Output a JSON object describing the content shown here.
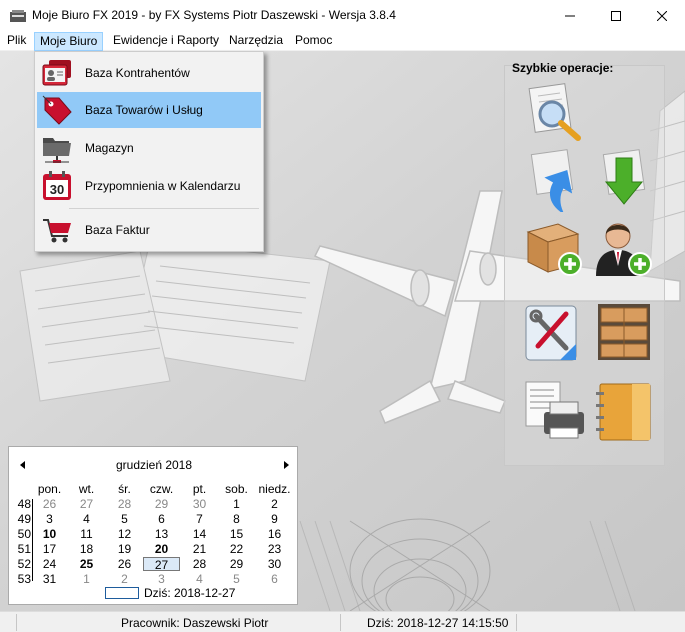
{
  "window": {
    "title": "Moje Biuro FX 2019 - by FX Systems Piotr Daszewski  - Wersja 3.8.4"
  },
  "menubar": {
    "items": [
      {
        "label": "Plik"
      },
      {
        "label": "Moje Biuro"
      },
      {
        "label": "Ewidencje i Raporty"
      },
      {
        "label": "Narzędzia"
      },
      {
        "label": "Pomoc"
      }
    ]
  },
  "dropdown": {
    "items": [
      {
        "label": "Baza Kontrahentów",
        "icon": "contacts-card-icon"
      },
      {
        "label": "Baza Towarów i Usług",
        "icon": "price-tag-icon"
      },
      {
        "label": "Magazyn",
        "icon": "network-folder-icon"
      },
      {
        "label": "Przypomnienia w Kalendarzu",
        "icon": "calendar-30-icon",
        "icon_text": "30"
      },
      {
        "label": "Baza Faktur",
        "icon": "shopping-cart-icon"
      }
    ],
    "highlighted_index": 1
  },
  "quick_ops": {
    "title": "Szybkie operacje:",
    "buttons": [
      {
        "icon": "invoice-search-icon"
      },
      {
        "icon": "invoice-export-icon"
      },
      {
        "icon": "invoice-import-icon"
      },
      {
        "icon": "add-goods-icon"
      },
      {
        "icon": "add-contractor-icon"
      },
      {
        "icon": "settings-tools-icon"
      },
      {
        "icon": "warehouse-shelves-icon"
      },
      {
        "icon": "print-document-icon"
      },
      {
        "icon": "address-book-icon"
      }
    ]
  },
  "calendar": {
    "month_label": "grudzień 2018",
    "day_headers": [
      "pon.",
      "wt.",
      "śr.",
      "czw.",
      "pt.",
      "sob.",
      "niedz."
    ],
    "weeks": [
      {
        "week": "48",
        "days": [
          {
            "d": "26",
            "other": true
          },
          {
            "d": "27",
            "other": true
          },
          {
            "d": "28",
            "other": true
          },
          {
            "d": "29",
            "other": true
          },
          {
            "d": "30",
            "other": true
          },
          {
            "d": "1"
          },
          {
            "d": "2"
          }
        ]
      },
      {
        "week": "49",
        "days": [
          {
            "d": "3"
          },
          {
            "d": "4"
          },
          {
            "d": "5"
          },
          {
            "d": "6"
          },
          {
            "d": "7"
          },
          {
            "d": "8"
          },
          {
            "d": "9"
          }
        ]
      },
      {
        "week": "50",
        "days": [
          {
            "d": "10",
            "bold": true
          },
          {
            "d": "11"
          },
          {
            "d": "12"
          },
          {
            "d": "13"
          },
          {
            "d": "14"
          },
          {
            "d": "15"
          },
          {
            "d": "16"
          }
        ]
      },
      {
        "week": "51",
        "days": [
          {
            "d": "17"
          },
          {
            "d": "18"
          },
          {
            "d": "19"
          },
          {
            "d": "20",
            "bold": true
          },
          {
            "d": "21"
          },
          {
            "d": "22"
          },
          {
            "d": "23"
          }
        ]
      },
      {
        "week": "52",
        "days": [
          {
            "d": "24"
          },
          {
            "d": "25",
            "bold": true
          },
          {
            "d": "26"
          },
          {
            "d": "27",
            "today": true
          },
          {
            "d": "28"
          },
          {
            "d": "29"
          },
          {
            "d": "30"
          }
        ]
      },
      {
        "week": "53",
        "days": [
          {
            "d": "31"
          },
          {
            "d": "1",
            "other": true
          },
          {
            "d": "2",
            "other": true
          },
          {
            "d": "3",
            "other": true
          },
          {
            "d": "4",
            "other": true
          },
          {
            "d": "5",
            "other": true
          },
          {
            "d": "6",
            "other": true
          }
        ]
      }
    ],
    "today_label": "Dziś: 2018-12-27"
  },
  "status": {
    "employee": "Pracownik: Daszewski Piotr",
    "datetime": "Dziś: 2018-12-27 14:15:50"
  },
  "colors": {
    "menu_active_bg": "#cce8ff",
    "dropdown_highlight": "#91c9f7",
    "icon_red": "#c8102e",
    "icon_blue": "#3a8ee6",
    "icon_green": "#4caf2a"
  }
}
